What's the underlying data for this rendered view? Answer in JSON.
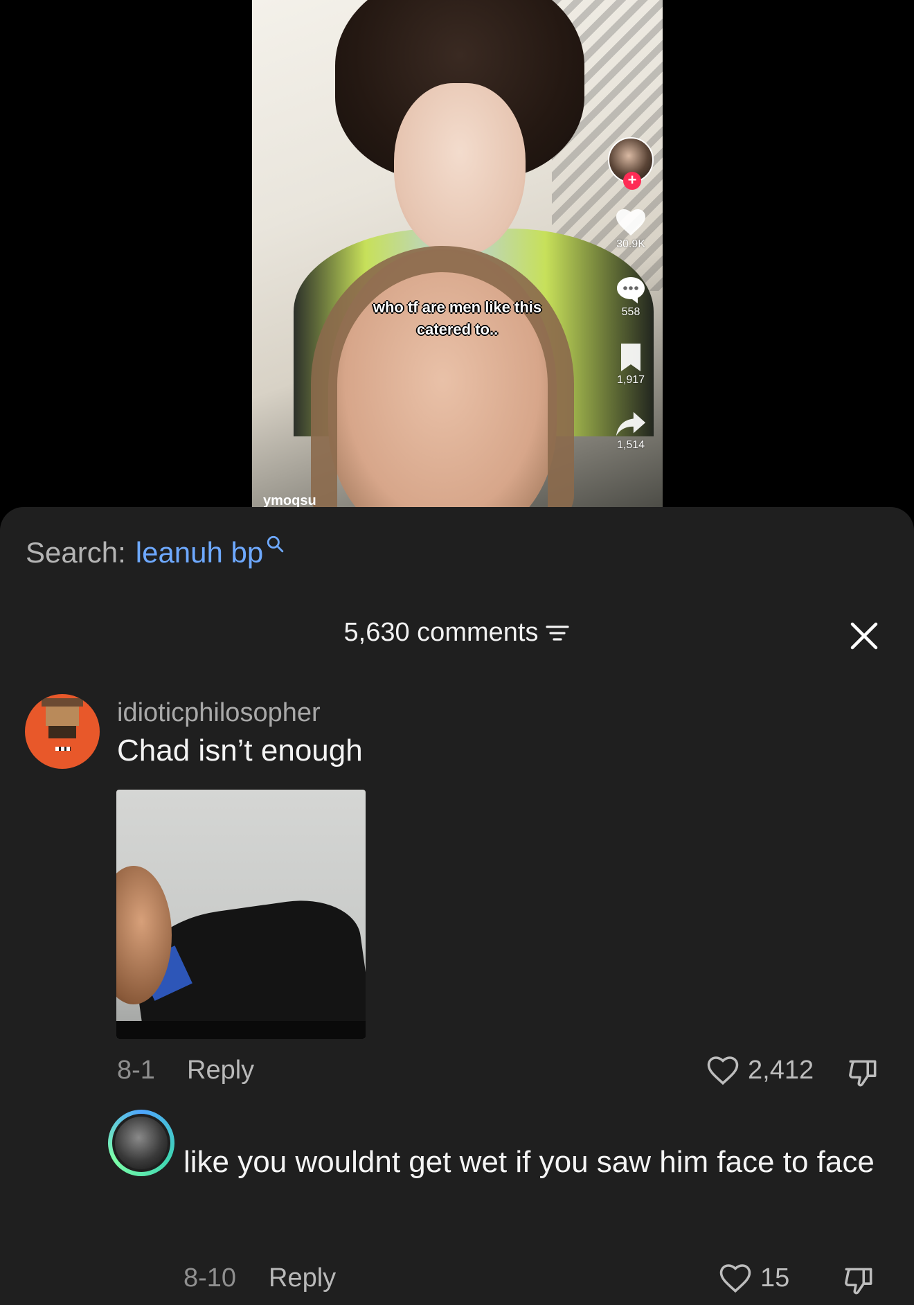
{
  "video": {
    "caption_line1": "who tf are men like this",
    "caption_line2": "catered to..",
    "creator_handle": "ymoqsu",
    "likes": "30.9K",
    "comments": "558",
    "saves": "1,917",
    "shares": "1,514"
  },
  "search": {
    "label": "Search:",
    "term": "leanuh bp"
  },
  "comments_header": {
    "count_label": "5,630 comments"
  },
  "comments": [
    {
      "username": "idioticphilosopher",
      "text": "Chad isn’t enough",
      "date": "8-1",
      "reply_label": "Reply",
      "likes": "2,412"
    },
    {
      "username": "",
      "text": "like you wouldnt get wet if you saw him face to face",
      "date": "8-10",
      "reply_label": "Reply",
      "likes": "15"
    }
  ],
  "colors": {
    "sheet_bg": "#1f1f1f",
    "search_term": "#6ea9ff",
    "plus_badge": "#fe2c55"
  }
}
